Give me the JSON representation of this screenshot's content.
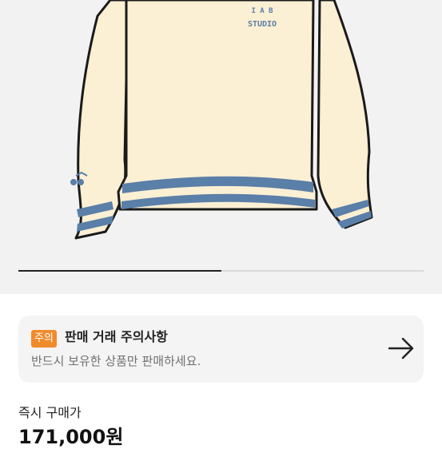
{
  "product": {
    "image_alt": "sweatshirt-illustration",
    "logo_line1": "I A B",
    "logo_line2": "STUDIO",
    "image_slider_progress": 0.5
  },
  "notice": {
    "badge": "주의",
    "title": "판매 거래 주의사항",
    "subtitle": "반드시 보유한 상품만 판매하세요.",
    "arrow_icon": "arrow-right-icon"
  },
  "price": {
    "label": "즉시 구매가",
    "value": "171,000원"
  },
  "colors": {
    "sweater": "#fbefd4",
    "outline": "#1a1a1a",
    "stripe": "#5a7fa8",
    "badge": "#f08b2b",
    "background": "#f2f2f2"
  }
}
